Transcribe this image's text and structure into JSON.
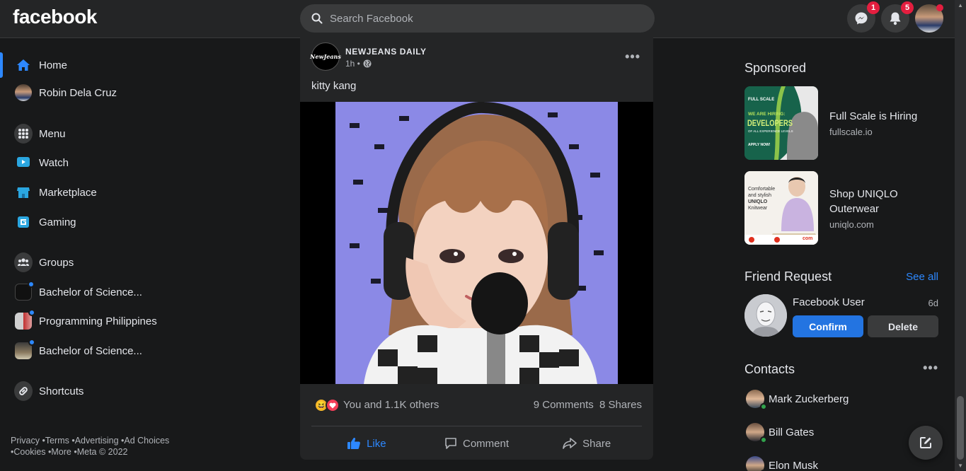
{
  "topbar": {
    "logo": "facebook",
    "search_placeholder": "Search Facebook",
    "messenger_badge": "1",
    "notifications_badge": "5"
  },
  "leftnav": {
    "items": [
      {
        "label": "Home",
        "icon": "home-icon"
      },
      {
        "label": "Robin Dela Cruz",
        "icon": "profile-avatar"
      },
      {
        "label": "Menu",
        "icon": "menu-grid-icon"
      },
      {
        "label": "Watch",
        "icon": "watch-icon"
      },
      {
        "label": "Marketplace",
        "icon": "marketplace-icon"
      },
      {
        "label": "Gaming",
        "icon": "gaming-icon"
      },
      {
        "label": "Groups",
        "icon": "groups-icon"
      },
      {
        "label": "Bachelor of Science...",
        "icon": "group-thumbnail"
      },
      {
        "label": "Programming Philippines",
        "icon": "group-thumbnail"
      },
      {
        "label": "Bachelor of Science...",
        "icon": "group-thumbnail"
      },
      {
        "label": "Shortcuts",
        "icon": "link-icon"
      }
    ],
    "footer_line1": "Privacy •Terms •Advertising •Ad Choices",
    "footer_line2": "•Cookies •More •Meta © 2022"
  },
  "post": {
    "page_name": "NEWJEANS DAILY",
    "avatar_text": "NewJeans",
    "time": "1h •",
    "text": "kitty kang",
    "reactions_text": "You and 1.1K others",
    "comments": "9 Comments",
    "shares": "8 Shares",
    "actions": {
      "like": "Like",
      "comment": "Comment",
      "share": "Share"
    }
  },
  "right": {
    "sponsored_title": "Sponsored",
    "ads": [
      {
        "title": "Full Scale is Hiring",
        "domain": "fullscale.io",
        "img_text_1": "FULL SCALE",
        "img_text_2": "WE ARE HIRING:",
        "img_text_3": "DEVELOPERS",
        "img_text_4": "OF ALL EXPERIENCE LEVELS",
        "img_text_5": "APPLY NOW!"
      },
      {
        "title": "Shop UNIQLO Outerwear",
        "domain": "uniqlo.com",
        "img_text_1": "Comfortable",
        "img_text_2": "and stylish",
        "img_text_3": "UNIQLO",
        "img_text_4": "Knitwear",
        "img_text_5": "com"
      }
    ],
    "friend_request": {
      "title": "Friend Request",
      "see_all": "See all",
      "name": "Facebook User",
      "time": "6d",
      "confirm": "Confirm",
      "delete": "Delete"
    },
    "contacts": {
      "title": "Contacts",
      "list": [
        "Mark Zuckerberg",
        "Bill Gates",
        "Elon Musk"
      ]
    }
  },
  "colors": {
    "accent": "#2d88ff",
    "badge": "#e41e3f",
    "online": "#31a24c",
    "background": "#18191a",
    "card": "#242526"
  }
}
